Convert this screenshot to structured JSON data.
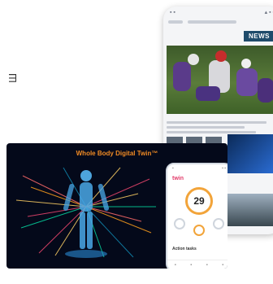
{
  "side_text": "Ш",
  "news_phone": {
    "tab_label": "NEWS",
    "colors": {
      "tab_bg": "#1f4b6b"
    }
  },
  "twin_card": {
    "title": "Whole Body Digital Twin™",
    "colors": {
      "title": "#f08a24",
      "bg": "#04091a"
    }
  },
  "app": {
    "brand": "twin",
    "ring_value": "29",
    "section_label": "Action tasks"
  }
}
